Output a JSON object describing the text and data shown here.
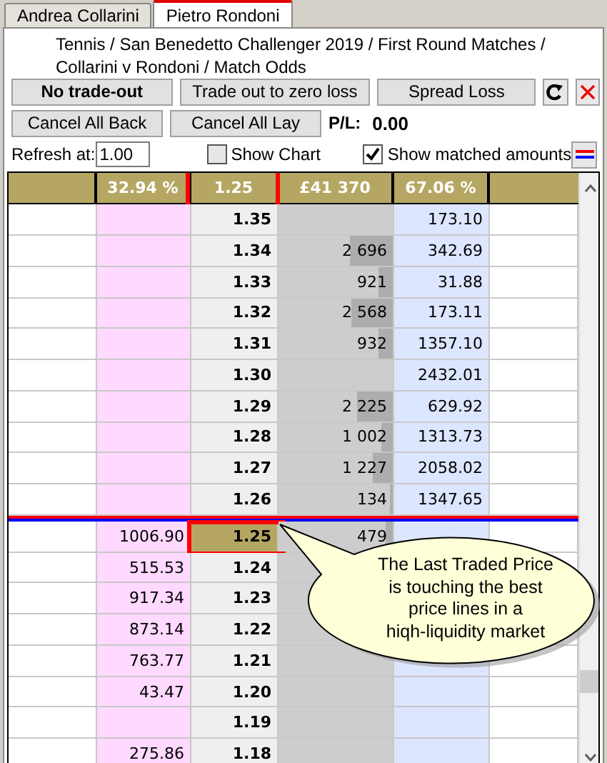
{
  "tabs": [
    {
      "label": "Andrea Collarini",
      "selected": false
    },
    {
      "label": "Pietro Rondoni",
      "selected": true
    }
  ],
  "breadcrumb": "Tennis / San Benedetto Challenger  2019 / First Round Matches / Collarini v Rondoni / Match Odds",
  "trade_buttons": [
    "No trade-out",
    "Trade out to zero loss",
    "Spread Loss"
  ],
  "cancel_buttons": [
    "Cancel All Back",
    "Cancel All Lay"
  ],
  "pl": {
    "label": "P/L:",
    "value": "0.00"
  },
  "refresh": {
    "label": "Refresh at:",
    "value": "1.00"
  },
  "options": [
    {
      "label": "Show Chart",
      "checked": false
    },
    {
      "label": "Show matched amounts",
      "checked": true
    }
  ],
  "header": {
    "back_percent": "32.94 %",
    "last_price": "1.25",
    "last_price_highlighted": true,
    "matched": "£41 370",
    "lay_percent": "67.06 %"
  },
  "rows": [
    {
      "price": "1.35",
      "lay": "173.10"
    },
    {
      "price": "1.34",
      "volume": "2 696",
      "level": 0.38,
      "lay": "342.69"
    },
    {
      "price": "1.33",
      "volume": "921",
      "level": 0.13,
      "lay": "31.88"
    },
    {
      "price": "1.32",
      "volume": "2 568",
      "level": 0.36,
      "lay": "173.11"
    },
    {
      "price": "1.31",
      "volume": "932",
      "level": 0.13,
      "lay": "1357.10"
    },
    {
      "price": "1.30",
      "lay": "2432.01"
    },
    {
      "price": "1.29",
      "volume": "2 225",
      "level": 0.31,
      "lay": "629.92"
    },
    {
      "price": "1.28",
      "volume": "1 002",
      "level": 0.1,
      "lay": "1313.73"
    },
    {
      "price": "1.27",
      "volume": "1 227",
      "level": 0.17,
      "lay": "2058.02"
    },
    {
      "price": "1.26",
      "volume": "134",
      "level": 0.03,
      "lay": "1347.65"
    },
    {
      "price": "1.25",
      "back": "1006.90",
      "volume": "479",
      "level": 0.06,
      "last_traded": true,
      "highlighted": true,
      "divider_above": true
    },
    {
      "price": "1.24",
      "back": "515.53"
    },
    {
      "price": "1.23",
      "back": "917.34"
    },
    {
      "price": "1.22",
      "back": "873.14"
    },
    {
      "price": "1.21",
      "back": "763.77"
    },
    {
      "price": "1.20",
      "back": "43.47"
    },
    {
      "price": "1.19"
    },
    {
      "price": "1.18",
      "back": "275.86"
    }
  ],
  "callout": "The Last Traded Price\nis touching the best\nprice lines in a\nhiqh-liquidity market"
}
